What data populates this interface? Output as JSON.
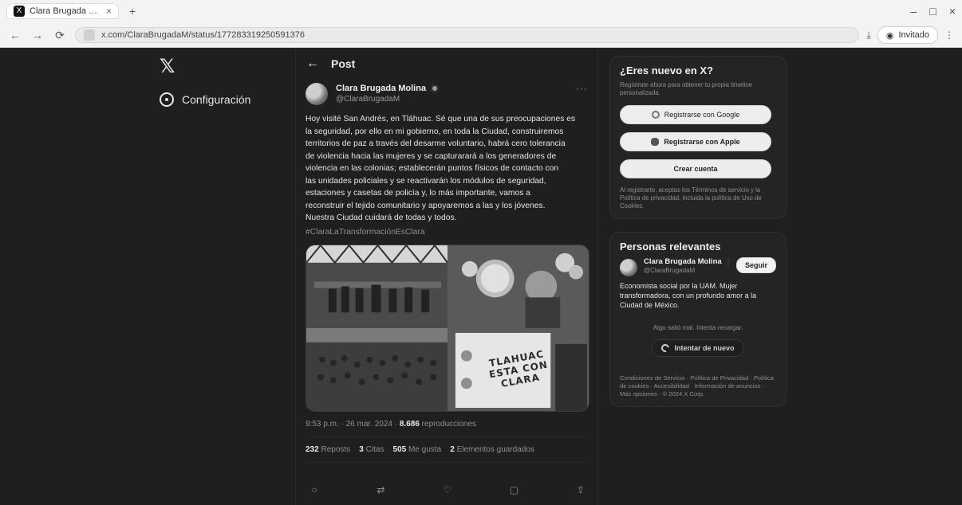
{
  "browser": {
    "tab_title": "Clara Brugada Molina en X",
    "tab_close": "×",
    "url": "x.com/ClaraBrugadaM/status/177283319250591376",
    "profile_label": "Invitado"
  },
  "left_nav": {
    "logo": "𝕏",
    "config_label": "Configuración"
  },
  "post": {
    "header_title": "Post",
    "author_name": "Clara Brugada Molina",
    "author_handle": "@ClaraBrugadaM",
    "more": "···",
    "text": "Hoy visité San Andrés, en Tláhuac. Sé que una de sus preocupaciones es\nla seguridad, por ello en mi gobierno, en toda la Ciudad, construiremos\nterritorios de paz a través del desarme voluntario, habrá cero tolerancia\nde violencia hacia las mujeres y se capturarará a los generadores de\nviolencia en las colonias; establecerán puntos físicos de contacto con\nlas unidades policiales y se reactivarán los módulos de seguridad,\nestaciones y casetas de policía y, lo más importante, vamos a\nreconstruir el tejido comunitario y apoyaremos a las y los jóvenes.\nNuestra Ciudad cuidará de todas y todos.",
    "hashtags": "#ClaraLaTransformaciónEsClara",
    "media_sign_text": "TLAHUAC\nESTA CON\nCLARA",
    "meta": {
      "time": "9:53 p.m.",
      "date": "26 mar. 2024",
      "views_count": "8.686",
      "views_label": "reproducciones"
    },
    "stats": {
      "reposts": "232",
      "reposts_label": "Reposts",
      "quotes": "3",
      "quotes_label": "Citas",
      "likes": "505",
      "likes_label": "Me gusta",
      "saves": "2",
      "saves_label": "Elementos guardados"
    }
  },
  "right_panel": {
    "signup_title": "¿Eres nuevo en X?",
    "signup_sub": "Regístrate ahora para obtener tu propia timeline personalizada.",
    "btn_google": "Registrarse con Google",
    "btn_apple": "Registrarse con Apple",
    "btn_create": "Crear cuenta",
    "footnote": "Al registrarte, aceptas los Términos de servicio y la Política de privacidad, incluida la política de Uso de Cookies.",
    "people_title": "Personas relevantes",
    "person_name": "Clara Brugada Molina",
    "person_handle": "@ClaraBrugadaM",
    "follow": "Seguir",
    "bio": "Economista social por la UAM. Mujer transformadora, con un profundo amor a la Ciudad de México.",
    "error_text": "Algo salió mal. Intenta recargar.",
    "retry": "Intentar de nuevo",
    "footer": "Condiciones de Servicio · Política de Privacidad · Política de cookies · Accesibilidad · Información de anuncios · Más opciones · © 2024 X Corp."
  },
  "colors": {
    "app_bg": "#1f1f1f",
    "card_bg": "#242424",
    "text_primary": "#f0f0f0",
    "text_muted": "#8f8f8f"
  },
  "icons": {
    "x_logo": "x-logo-icon",
    "settings": "gear-icon",
    "back": "arrow-left-icon",
    "verified": "verified-badge-icon",
    "google": "google-icon",
    "apple": "apple-icon",
    "refresh": "refresh-icon",
    "reply": "reply-icon",
    "repost": "repost-icon",
    "like": "like-icon",
    "bookmark": "bookmark-icon",
    "share": "share-icon"
  }
}
